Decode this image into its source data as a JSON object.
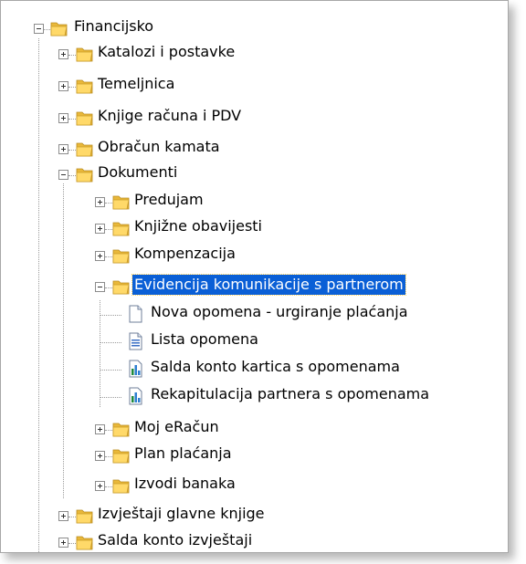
{
  "tree": {
    "root": {
      "label": "Financijsko",
      "expanded": true,
      "icon": "folder-icon"
    },
    "level1": [
      {
        "label": "Katalozi i postavke",
        "expanded": false,
        "icon": "folder-icon"
      },
      {
        "label": "Temeljnica",
        "expanded": false,
        "icon": "folder-icon"
      },
      {
        "label": "Knjige računa i PDV",
        "expanded": false,
        "icon": "folder-icon"
      },
      {
        "label": "Obračun kamata",
        "expanded": false,
        "icon": "folder-icon"
      },
      {
        "label": "Dokumenti",
        "expanded": true,
        "icon": "folder-icon"
      },
      {
        "label": "Izvještaji glavne knjige",
        "expanded": false,
        "icon": "folder-icon"
      },
      {
        "label": "Salda konto izvještaji",
        "expanded": false,
        "icon": "folder-icon"
      }
    ],
    "dokumenti": [
      {
        "label": "Predujam",
        "expanded": false,
        "icon": "folder-icon"
      },
      {
        "label": "Knjižne obavijesti",
        "expanded": false,
        "icon": "folder-icon"
      },
      {
        "label": "Kompenzacija",
        "expanded": false,
        "icon": "folder-icon"
      },
      {
        "label": "Evidencija komunikacije s partnerom",
        "expanded": true,
        "selected": true,
        "icon": "folder-icon"
      },
      {
        "label": "Moj eRačun",
        "expanded": false,
        "icon": "folder-icon"
      },
      {
        "label": "Plan plaćanja",
        "expanded": false,
        "icon": "folder-icon"
      },
      {
        "label": "Izvodi banaka",
        "expanded": false,
        "icon": "folder-icon"
      }
    ],
    "evidencija": [
      {
        "label": "Nova opomena - urgiranje plaćanja",
        "icon": "new-document-icon"
      },
      {
        "label": "Lista opomena",
        "icon": "list-document-icon"
      },
      {
        "label": "Salda konto kartica s opomenama",
        "icon": "report-chart-icon"
      },
      {
        "label": "Rekapitulacija partnera s opomenama",
        "icon": "report-chart-icon"
      }
    ]
  },
  "colors": {
    "selection": "#0a5fd6",
    "folder": "#f2c84b",
    "chart": "#2d7fd0"
  }
}
